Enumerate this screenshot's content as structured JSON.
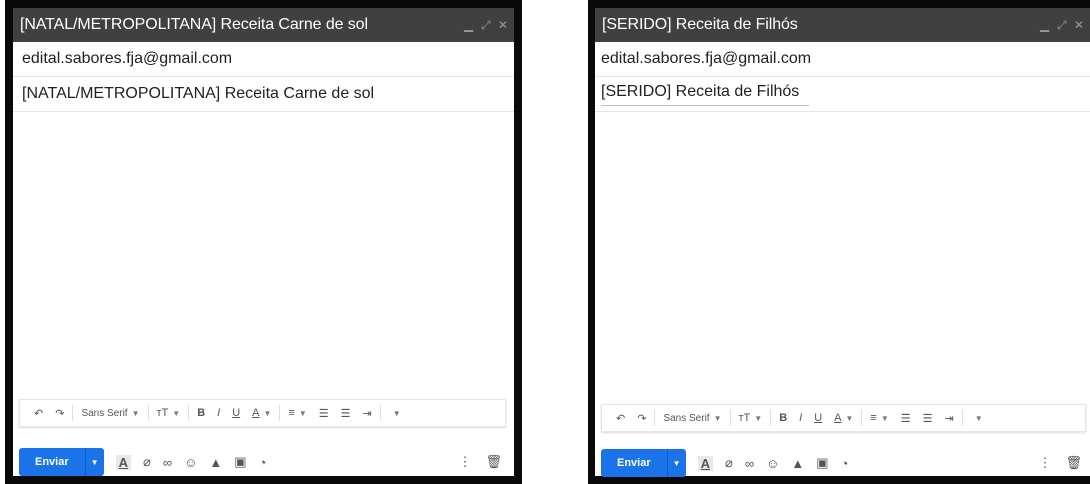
{
  "left": {
    "title": "[NATAL/METROPOLITANA] Receita Carne de sol",
    "to": "edital.sabores.fja@gmail.com",
    "subject": "[NATAL/METROPOLITANA] Receita Carne de sol"
  },
  "right": {
    "title": "[SERIDO] Receita de Filhós",
    "to": "edital.sabores.fja@gmail.com",
    "subject": "[SERIDO] Receita de Filhós"
  },
  "toolbar": {
    "font": "Sans Serif",
    "send_label": "Enviar"
  },
  "icons": [
    "undo-icon",
    "redo-icon",
    "font-size-icon",
    "bold-icon",
    "italic-icon",
    "underline-icon",
    "text-color-icon",
    "align-icon",
    "numbered-list-icon",
    "bulleted-list-icon",
    "indent-icon",
    "more-formatting-icon",
    "formatting-options-icon",
    "attach-icon",
    "link-icon",
    "emoji-icon",
    "drive-icon",
    "photo-icon",
    "confidential-icon",
    "more-options-icon",
    "discard-icon",
    "minimize-icon",
    "expand-icon",
    "close-icon"
  ],
  "colors": {
    "titlebar": "#404040",
    "send": "#1a73e8",
    "frame": "#0a0a0a"
  }
}
